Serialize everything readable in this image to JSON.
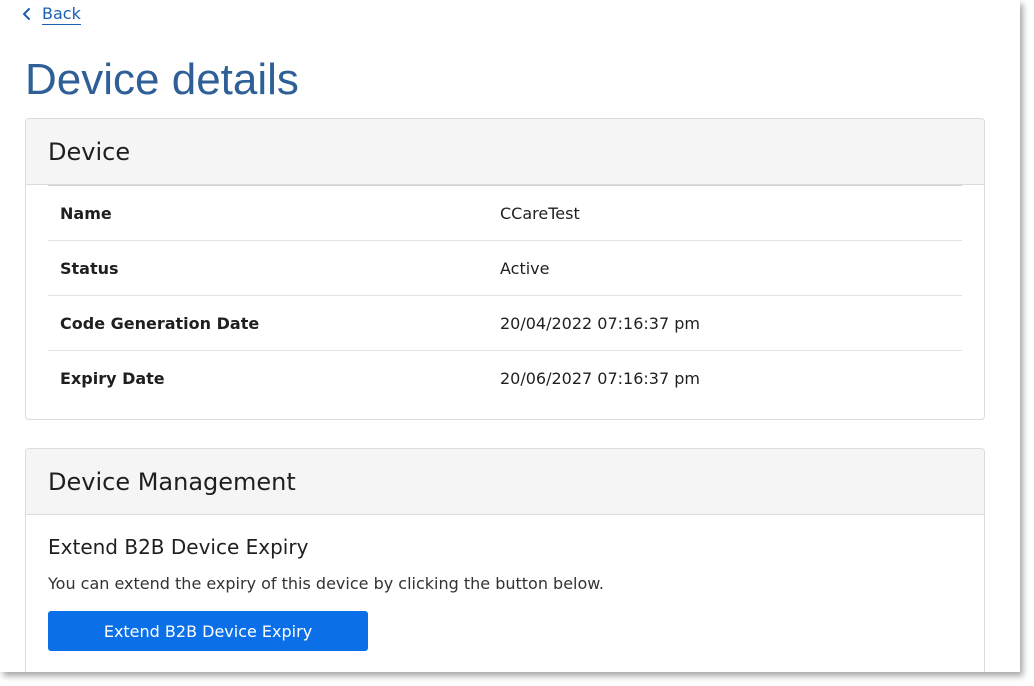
{
  "nav": {
    "back_label": "Back"
  },
  "page": {
    "title": "Device details"
  },
  "device_card": {
    "heading": "Device",
    "rows": [
      {
        "label": "Name",
        "value": "CCareTest"
      },
      {
        "label": "Status",
        "value": "Active"
      },
      {
        "label": "Code Generation Date",
        "value": "20/04/2022 07:16:37 pm"
      },
      {
        "label": "Expiry Date",
        "value": "20/06/2027 07:16:37 pm"
      }
    ]
  },
  "management_card": {
    "heading": "Device Management",
    "section_title": "Extend B2B Device Expiry",
    "description": "You can extend the expiry of this device by clicking the button below.",
    "button_label": "Extend B2B Device Expiry"
  },
  "icons": {
    "back": "chevron-left-icon"
  },
  "colors": {
    "link": "#1a5fb4",
    "title": "#2e6097",
    "primary_button": "#0b6fe8",
    "card_header_bg": "#f5f5f5"
  }
}
